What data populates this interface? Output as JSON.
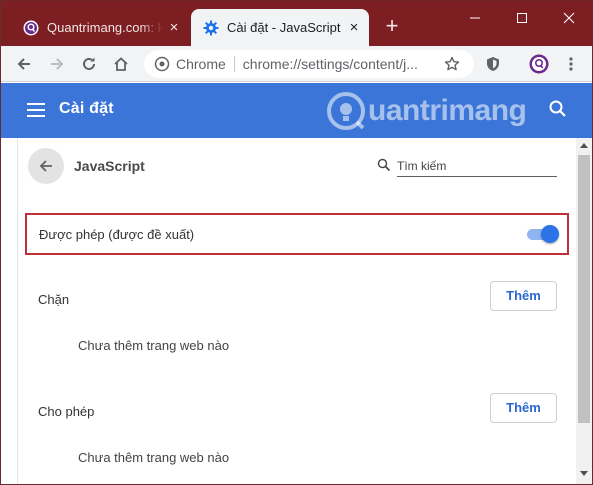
{
  "tabs": [
    {
      "title": "Quantrimang.com: Kiến",
      "favicon": "quantrimang-favicon-icon",
      "close": "×"
    },
    {
      "title": "Cài đặt - JavaScript",
      "favicon": "gear-icon",
      "close": "×"
    }
  ],
  "new_tab": "+",
  "omnibox": {
    "chip": "Chrome",
    "url": "chrome://settings/content/j..."
  },
  "settings": {
    "header_title": "Cài đặt",
    "watermark": "uantrimang"
  },
  "page": {
    "title": "JavaScript",
    "search_placeholder": "Tìm kiếm",
    "allowed_label": "Được phép (được đề xuất)",
    "allowed_toggle_on": true,
    "block_label": "Chặn",
    "allow_label": "Cho phép",
    "add_button_label": "Thêm",
    "empty_message": "Chưa thêm trang web nào"
  },
  "colors": {
    "tabstrip": "#7d1f22",
    "header": "#3c75d8",
    "toggle": "#2b73e6",
    "highlight_border": "#c0303a",
    "button_text": "#2a66d1"
  }
}
